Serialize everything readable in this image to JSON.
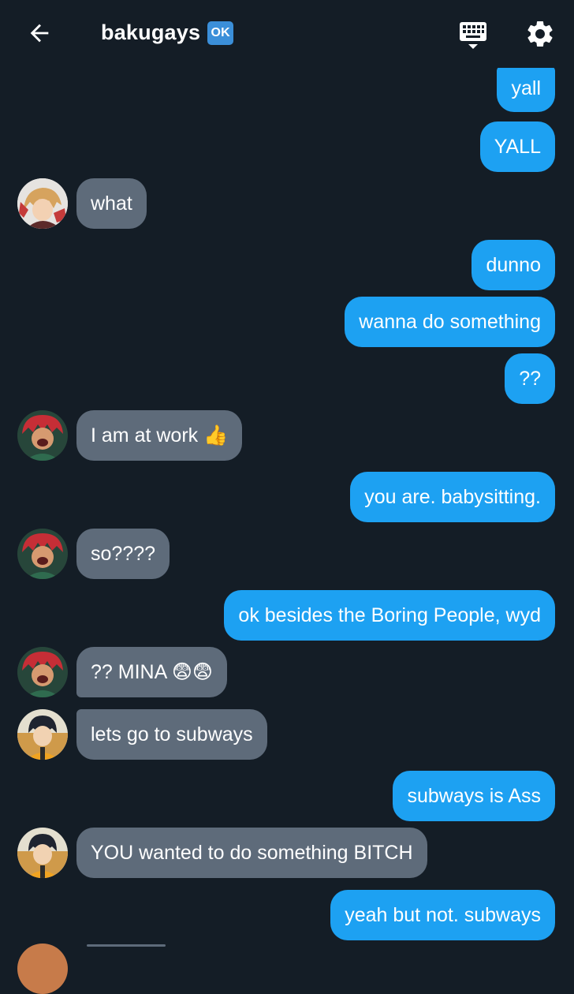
{
  "header": {
    "title": "bakugays",
    "badge": "OK"
  },
  "messages": [
    {
      "from": "me",
      "text": "yall"
    },
    {
      "from": "me",
      "text": "YALL"
    },
    {
      "from": "other",
      "avatar": "blonde-avatar",
      "text": "what"
    },
    {
      "from": "me",
      "text": "dunno"
    },
    {
      "from": "me",
      "text": "wanna do something"
    },
    {
      "from": "me",
      "text": "??"
    },
    {
      "from": "other",
      "avatar": "redhead-avatar",
      "text": "I am at work 👍"
    },
    {
      "from": "me",
      "text": "you are. babysitting."
    },
    {
      "from": "other",
      "avatar": "redhead-avatar",
      "text": "so????"
    },
    {
      "from": "me",
      "text": "ok besides the Boring People, wyd"
    },
    {
      "from": "other",
      "avatar": "redhead-avatar",
      "text": "?? MINA 😨😨"
    },
    {
      "from": "other",
      "avatar": "darkhair-avatar",
      "text": "lets go to subways"
    },
    {
      "from": "me",
      "text": "subways is Ass"
    },
    {
      "from": "other",
      "avatar": "darkhair-avatar",
      "text": "YOU wanted to do something BITCH"
    },
    {
      "from": "me",
      "text": "yeah but not. subways"
    }
  ],
  "colors": {
    "background": "#141d26",
    "sent_bubble": "#1da1f2",
    "received_bubble": "#5e6b7a",
    "badge": "#3b8fd9"
  }
}
